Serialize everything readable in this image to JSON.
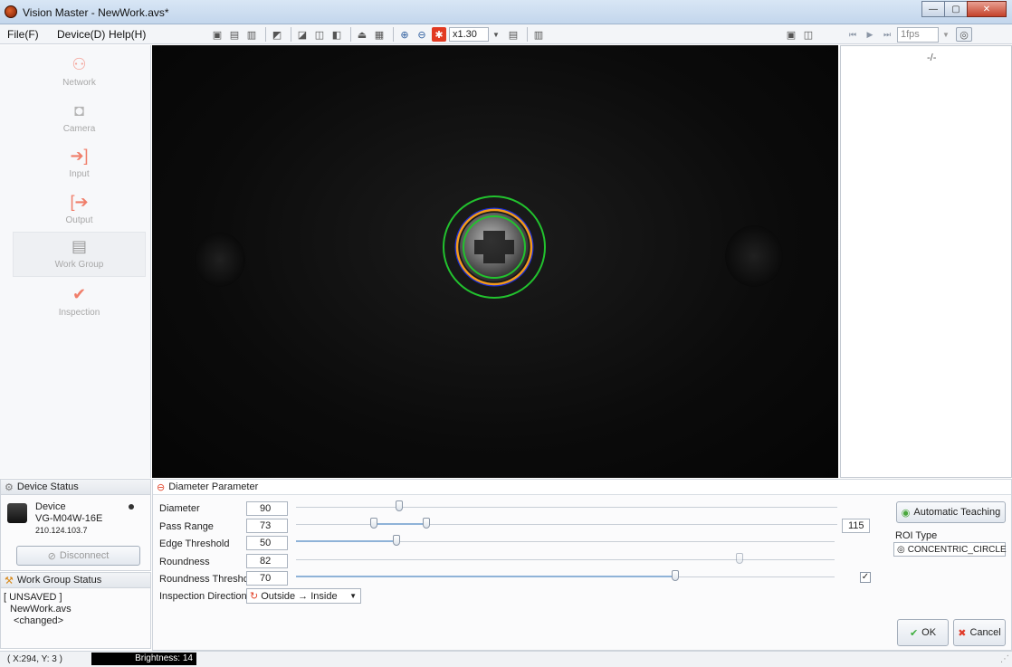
{
  "window": {
    "title": "Vision Master - NewWork.avs*"
  },
  "menu": {
    "file": "File(F)",
    "device": "Device(D)",
    "help": "Help(H)"
  },
  "toolbar": {
    "zoom_value": "x1.30",
    "fps_value": "1fps"
  },
  "sidebar": {
    "items": [
      {
        "label": "Network",
        "icon": "network-icon"
      },
      {
        "label": "Camera",
        "icon": "camera-icon"
      },
      {
        "label": "Input",
        "icon": "input-arrow-icon"
      },
      {
        "label": "Output",
        "icon": "output-arrow-icon"
      },
      {
        "label": "Work Group",
        "icon": "clipboard-icon"
      },
      {
        "label": "Inspection",
        "icon": "checkmark-icon"
      }
    ]
  },
  "right_panel": {
    "frame_counter": "-/-"
  },
  "device_status": {
    "header": "Device Status",
    "device_name": "Device",
    "model": "VG-M04W-16E",
    "ip": "210.124.103.7",
    "disconnect_label": "Disconnect"
  },
  "work_group_status": {
    "header": "Work Group Status",
    "state": "[ UNSAVED ]",
    "file": "NewWork.avs",
    "change": "<changed>"
  },
  "parameters": {
    "header": "Diameter Parameter",
    "diameter": {
      "label": "Diameter",
      "value": "90",
      "level": 0.19
    },
    "pass_range": {
      "label": "Pass Range",
      "min": "73",
      "max": "115",
      "level_min": 0.143,
      "level_max": 0.24
    },
    "edge_threshold": {
      "label": "Edge Threshold",
      "value": "50",
      "level": 0.186
    },
    "roundness": {
      "label": "Roundness",
      "value": "82",
      "level": 0.82
    },
    "roundness_threshold": {
      "label": "Roundness Threshold",
      "value": "70",
      "level": 0.7,
      "enabled": true
    },
    "inspection_direction": {
      "label": "Inspection Direction",
      "value": "Outside → Inside"
    },
    "automatic_teaching_label": "Automatic Teaching",
    "roi_type_label": "ROI Type",
    "roi_type_value": "CONCENTRIC_CIRCLE",
    "ok_label": "OK",
    "cancel_label": "Cancel"
  },
  "statusbar": {
    "coords": "( X:294, Y:  3 )",
    "brightness": "Brightness: 14"
  },
  "colors": {
    "outer_ring": "#22c22e",
    "orange_ring": "#f39a1c",
    "blue_ring": "#1a2fd6",
    "accent": "#3c8fd8"
  }
}
